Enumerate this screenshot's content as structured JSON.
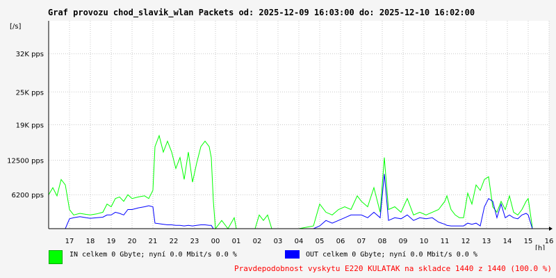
{
  "chart_data": {
    "type": "line",
    "title": "Graf provozu chod_slavik_wlan Packets od: 2025-12-09 16:03:00 do: 2025-12-10 16:02:00",
    "ylabel": "[/s]",
    "xlabel": "[h]",
    "xlim": [
      16,
      40
    ],
    "ylim": [
      0,
      38000
    ],
    "grid": true,
    "y_ticks": [
      {
        "value": 6200,
        "label": "6200 pps"
      },
      {
        "value": 12500,
        "label": "12500 pps"
      },
      {
        "value": 19000,
        "label": "19K pps"
      },
      {
        "value": 25000,
        "label": "25K pps"
      },
      {
        "value": 32000,
        "label": "32K pps"
      }
    ],
    "x_ticks": [
      {
        "value": 17,
        "label": "17"
      },
      {
        "value": 18,
        "label": "18"
      },
      {
        "value": 19,
        "label": "19"
      },
      {
        "value": 20,
        "label": "20"
      },
      {
        "value": 21,
        "label": "21"
      },
      {
        "value": 22,
        "label": "22"
      },
      {
        "value": 23,
        "label": "23"
      },
      {
        "value": 24,
        "label": "00"
      },
      {
        "value": 25,
        "label": "01"
      },
      {
        "value": 26,
        "label": "02"
      },
      {
        "value": 27,
        "label": "03"
      },
      {
        "value": 28,
        "label": "04"
      },
      {
        "value": 29,
        "label": "05"
      },
      {
        "value": 30,
        "label": "06"
      },
      {
        "value": 31,
        "label": "07"
      },
      {
        "value": 32,
        "label": "08"
      },
      {
        "value": 33,
        "label": "09"
      },
      {
        "value": 34,
        "label": "10"
      },
      {
        "value": 35,
        "label": "11"
      },
      {
        "value": 36,
        "label": "12"
      },
      {
        "value": 37,
        "label": "13"
      },
      {
        "value": 38,
        "label": "14"
      },
      {
        "value": 39,
        "label": "15"
      },
      {
        "value": 40,
        "label": "16"
      }
    ],
    "series": [
      {
        "name": "IN",
        "color": "#00ff00",
        "x": [
          16.0,
          16.2,
          16.4,
          16.6,
          16.8,
          17.0,
          17.2,
          17.5,
          17.8,
          18.0,
          18.3,
          18.6,
          18.8,
          19.0,
          19.2,
          19.4,
          19.6,
          19.8,
          20.0,
          20.3,
          20.6,
          20.8,
          21.0,
          21.1,
          21.3,
          21.5,
          21.7,
          21.9,
          22.1,
          22.3,
          22.5,
          22.7,
          22.9,
          23.1,
          23.3,
          23.5,
          23.7,
          23.8,
          23.9,
          24.0,
          24.3,
          24.6,
          24.9,
          25.0,
          25.3,
          25.6,
          25.9,
          26.1,
          26.3,
          26.5,
          26.7,
          27.0,
          28.0,
          28.7,
          29.0,
          29.3,
          29.6,
          29.9,
          30.2,
          30.5,
          30.8,
          31.0,
          31.3,
          31.6,
          31.9,
          32.1,
          32.3,
          32.6,
          32.9,
          33.2,
          33.5,
          33.8,
          34.1,
          34.4,
          34.7,
          35.0,
          35.1,
          35.3,
          35.5,
          35.7,
          35.9,
          36.1,
          36.3,
          36.5,
          36.7,
          36.9,
          37.1,
          37.3,
          37.5,
          37.7,
          37.9,
          38.1,
          38.3,
          38.5,
          38.7,
          38.9,
          39.0,
          39.2
        ],
        "values": [
          6200,
          7500,
          6000,
          9000,
          8000,
          3500,
          2500,
          2800,
          2600,
          2500,
          2700,
          3000,
          4500,
          4000,
          5500,
          5800,
          5000,
          6200,
          5500,
          5800,
          6000,
          5500,
          7000,
          15000,
          17000,
          14000,
          16000,
          14000,
          11000,
          13000,
          9000,
          14000,
          8500,
          12000,
          15000,
          16000,
          15000,
          13000,
          5000,
          0,
          1500,
          0,
          2000,
          0,
          0,
          0,
          0,
          2500,
          1500,
          2500,
          0,
          0,
          0,
          500,
          4500,
          3000,
          2500,
          3500,
          4000,
          3500,
          6000,
          5000,
          4000,
          7500,
          3000,
          13000,
          3500,
          4000,
          3000,
          5500,
          2500,
          3000,
          2500,
          3000,
          3500,
          5000,
          6000,
          3500,
          2500,
          2000,
          2000,
          6500,
          4500,
          8000,
          7000,
          9000,
          9500,
          4000,
          3000,
          5000,
          3500,
          6000,
          3000,
          2500,
          3500,
          5000,
          5500,
          200
        ]
      },
      {
        "name": "OUT",
        "color": "#0000ff",
        "x": [
          16.0,
          16.2,
          16.4,
          16.6,
          16.8,
          17.0,
          17.2,
          17.5,
          17.8,
          18.0,
          18.3,
          18.6,
          18.8,
          19.0,
          19.2,
          19.4,
          19.6,
          19.8,
          20.0,
          20.3,
          20.6,
          20.8,
          21.0,
          21.1,
          21.3,
          21.5,
          21.7,
          21.9,
          22.1,
          22.3,
          22.5,
          22.7,
          22.9,
          23.1,
          23.3,
          23.5,
          23.7,
          23.8,
          23.9,
          24.0,
          24.3,
          24.6,
          24.9,
          25.0,
          25.3,
          25.6,
          25.9,
          26.1,
          26.3,
          26.5,
          26.7,
          27.0,
          28.0,
          28.7,
          29.0,
          29.3,
          29.6,
          29.9,
          30.2,
          30.5,
          30.8,
          31.0,
          31.3,
          31.6,
          31.9,
          32.1,
          32.3,
          32.6,
          32.9,
          33.2,
          33.5,
          33.8,
          34.1,
          34.4,
          34.7,
          35.0,
          35.1,
          35.3,
          35.5,
          35.7,
          35.9,
          36.1,
          36.3,
          36.5,
          36.7,
          36.9,
          37.1,
          37.3,
          37.5,
          37.7,
          37.9,
          38.1,
          38.3,
          38.5,
          38.7,
          38.9,
          39.0,
          39.2
        ],
        "values": [
          0,
          0,
          0,
          0,
          0,
          1800,
          2000,
          2200,
          2000,
          1900,
          2000,
          2100,
          2500,
          2500,
          3000,
          2800,
          2500,
          3500,
          3500,
          3800,
          4000,
          4200,
          4000,
          1000,
          900,
          800,
          700,
          700,
          600,
          600,
          500,
          600,
          500,
          600,
          700,
          700,
          600,
          600,
          0,
          0,
          0,
          0,
          0,
          0,
          0,
          0,
          0,
          0,
          0,
          0,
          0,
          0,
          0,
          0,
          500,
          1500,
          1000,
          1500,
          2000,
          2500,
          2500,
          2500,
          2000,
          3000,
          2000,
          10000,
          1500,
          2000,
          1800,
          2500,
          1500,
          2000,
          1800,
          2000,
          1200,
          800,
          600,
          500,
          500,
          500,
          500,
          1000,
          800,
          1000,
          500,
          4000,
          5500,
          5000,
          2000,
          4500,
          2000,
          2500,
          2000,
          1800,
          2500,
          2800,
          2500,
          0
        ]
      }
    ]
  },
  "legend": {
    "in_text": "IN celkem 0 Gbyte; nyní   0.0 Mbit/s 0.0 %",
    "out_text": "OUT celkem 0 Gbyte; nyní   0.0 Mbit/s 0.0 %",
    "in_color": "#00ff00",
    "out_color": "#0000ff"
  },
  "footer": {
    "text": "Pravdepodobnost vyskytu E220 KULATAK na skladce 1440 z 1440 (100.0 %)",
    "color": "#ff0000"
  }
}
